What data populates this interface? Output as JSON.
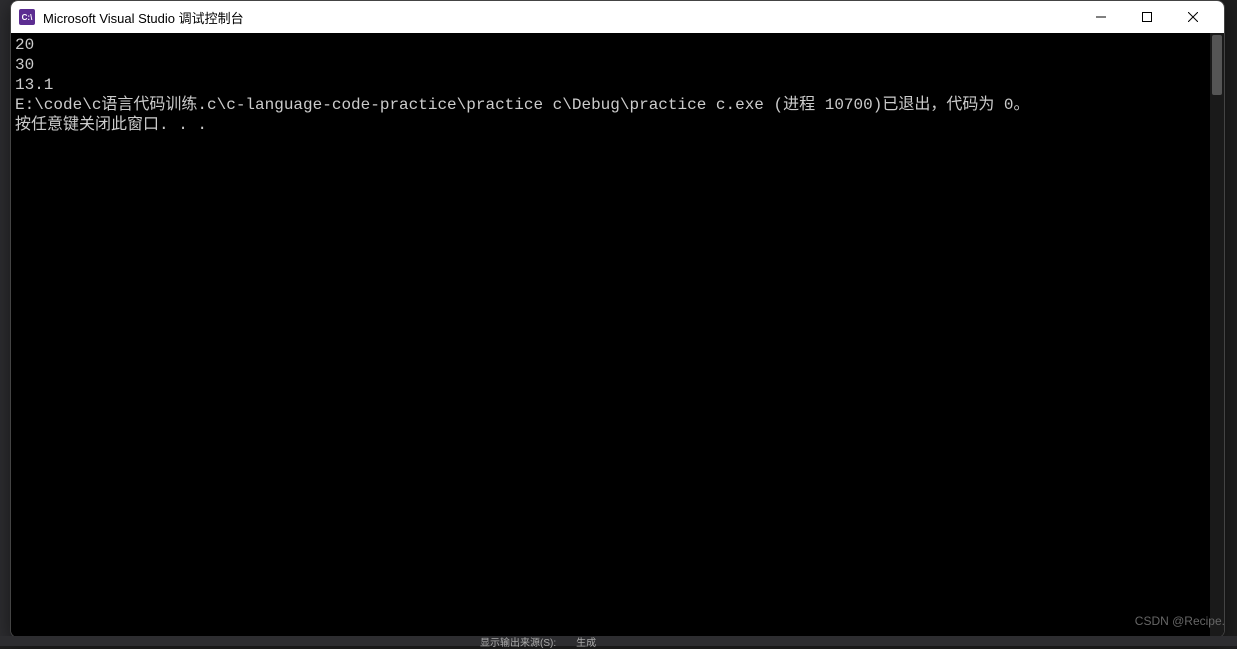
{
  "window": {
    "icon_text": "C:\\",
    "title": "Microsoft Visual Studio 调试控制台"
  },
  "console": {
    "lines": [
      "20",
      "30",
      "13.1",
      "",
      "E:\\code\\c语言代码训练.c\\c-language-code-practice\\practice c\\Debug\\practice c.exe (进程 10700)已退出，代码为 0。",
      "按任意键关闭此窗口. . ."
    ]
  },
  "bottom": {
    "label1": "显示输出来源(S):",
    "label2": "生成"
  },
  "watermark": "CSDN @Recipe."
}
